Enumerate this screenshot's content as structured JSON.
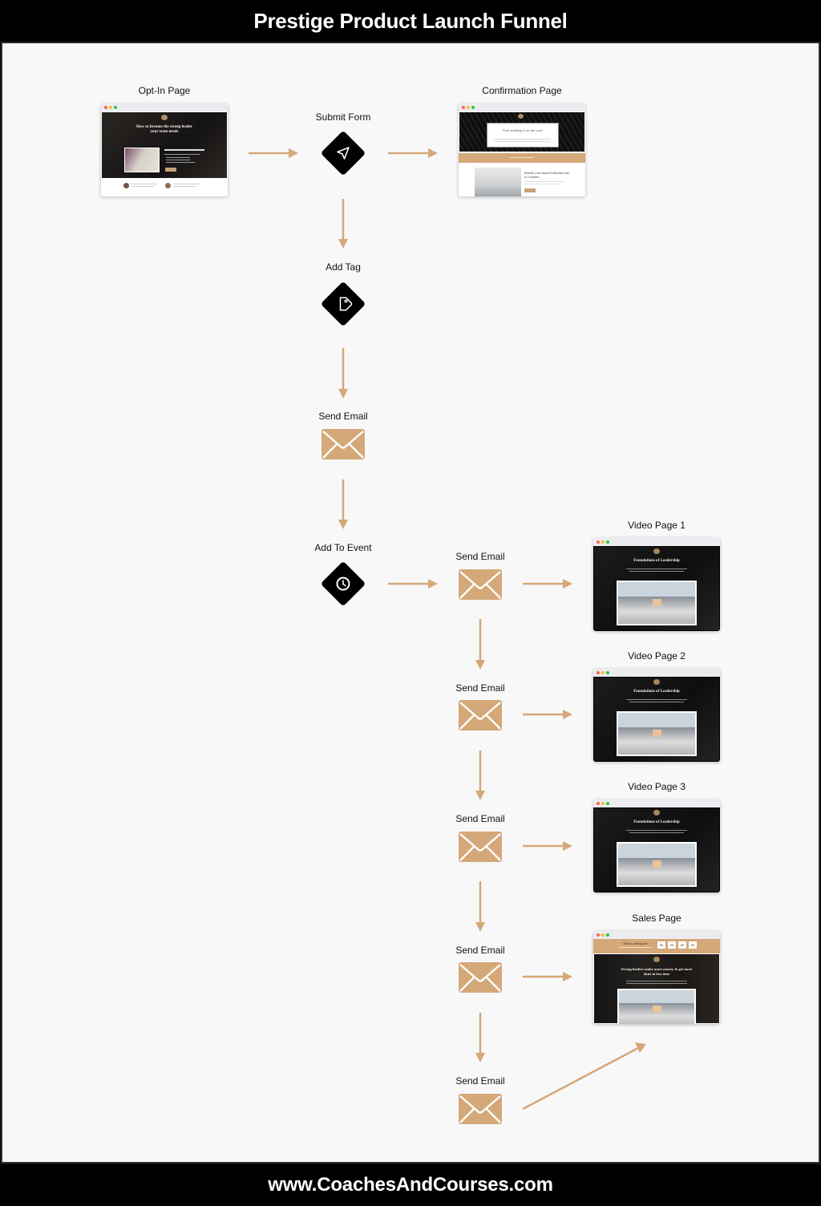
{
  "header": {
    "title": "Prestige Product Launch Funnel"
  },
  "footer": {
    "url": "www.CoachesAndCourses.com"
  },
  "colors": {
    "accent": "#d4a878",
    "node": "#000000",
    "background": "#f8f8f8"
  },
  "nodes": {
    "optin": {
      "label": "Opt-In Page",
      "headline": "How to become the strong leader your team needs"
    },
    "submit": {
      "label": "Submit Form",
      "icon": "send-icon"
    },
    "confirmation": {
      "label": "Confirmation Page",
      "headline": "Your training is on the way!",
      "subhead": "Identify your natural leadership style in 5 minutes"
    },
    "tag": {
      "label": "Add Tag",
      "icon": "tag-icon"
    },
    "email1": {
      "label": "Send Email",
      "icon": "envelope-icon"
    },
    "event": {
      "label": "Add To Event",
      "icon": "clock-icon"
    },
    "email2": {
      "label": "Send Email",
      "icon": "envelope-icon"
    },
    "video1": {
      "label": "Video Page 1",
      "headline": "Foundations of Leadership"
    },
    "email3": {
      "label": "Send Email",
      "icon": "envelope-icon"
    },
    "video2": {
      "label": "Video Page 2",
      "headline": "Foundations of Leadership"
    },
    "email4": {
      "label": "Send Email",
      "icon": "envelope-icon"
    },
    "video3": {
      "label": "Video Page 3",
      "headline": "Foundations of Leadership"
    },
    "email5": {
      "label": "Send Email",
      "icon": "envelope-icon"
    },
    "sales": {
      "label": "Sales Page",
      "headline": "Strong leaders make more money & get more done in less time",
      "banner": "Time is running out!",
      "countdown": [
        "00",
        "00",
        "00",
        "00"
      ]
    },
    "email6": {
      "label": "Send Email",
      "icon": "envelope-icon"
    }
  }
}
